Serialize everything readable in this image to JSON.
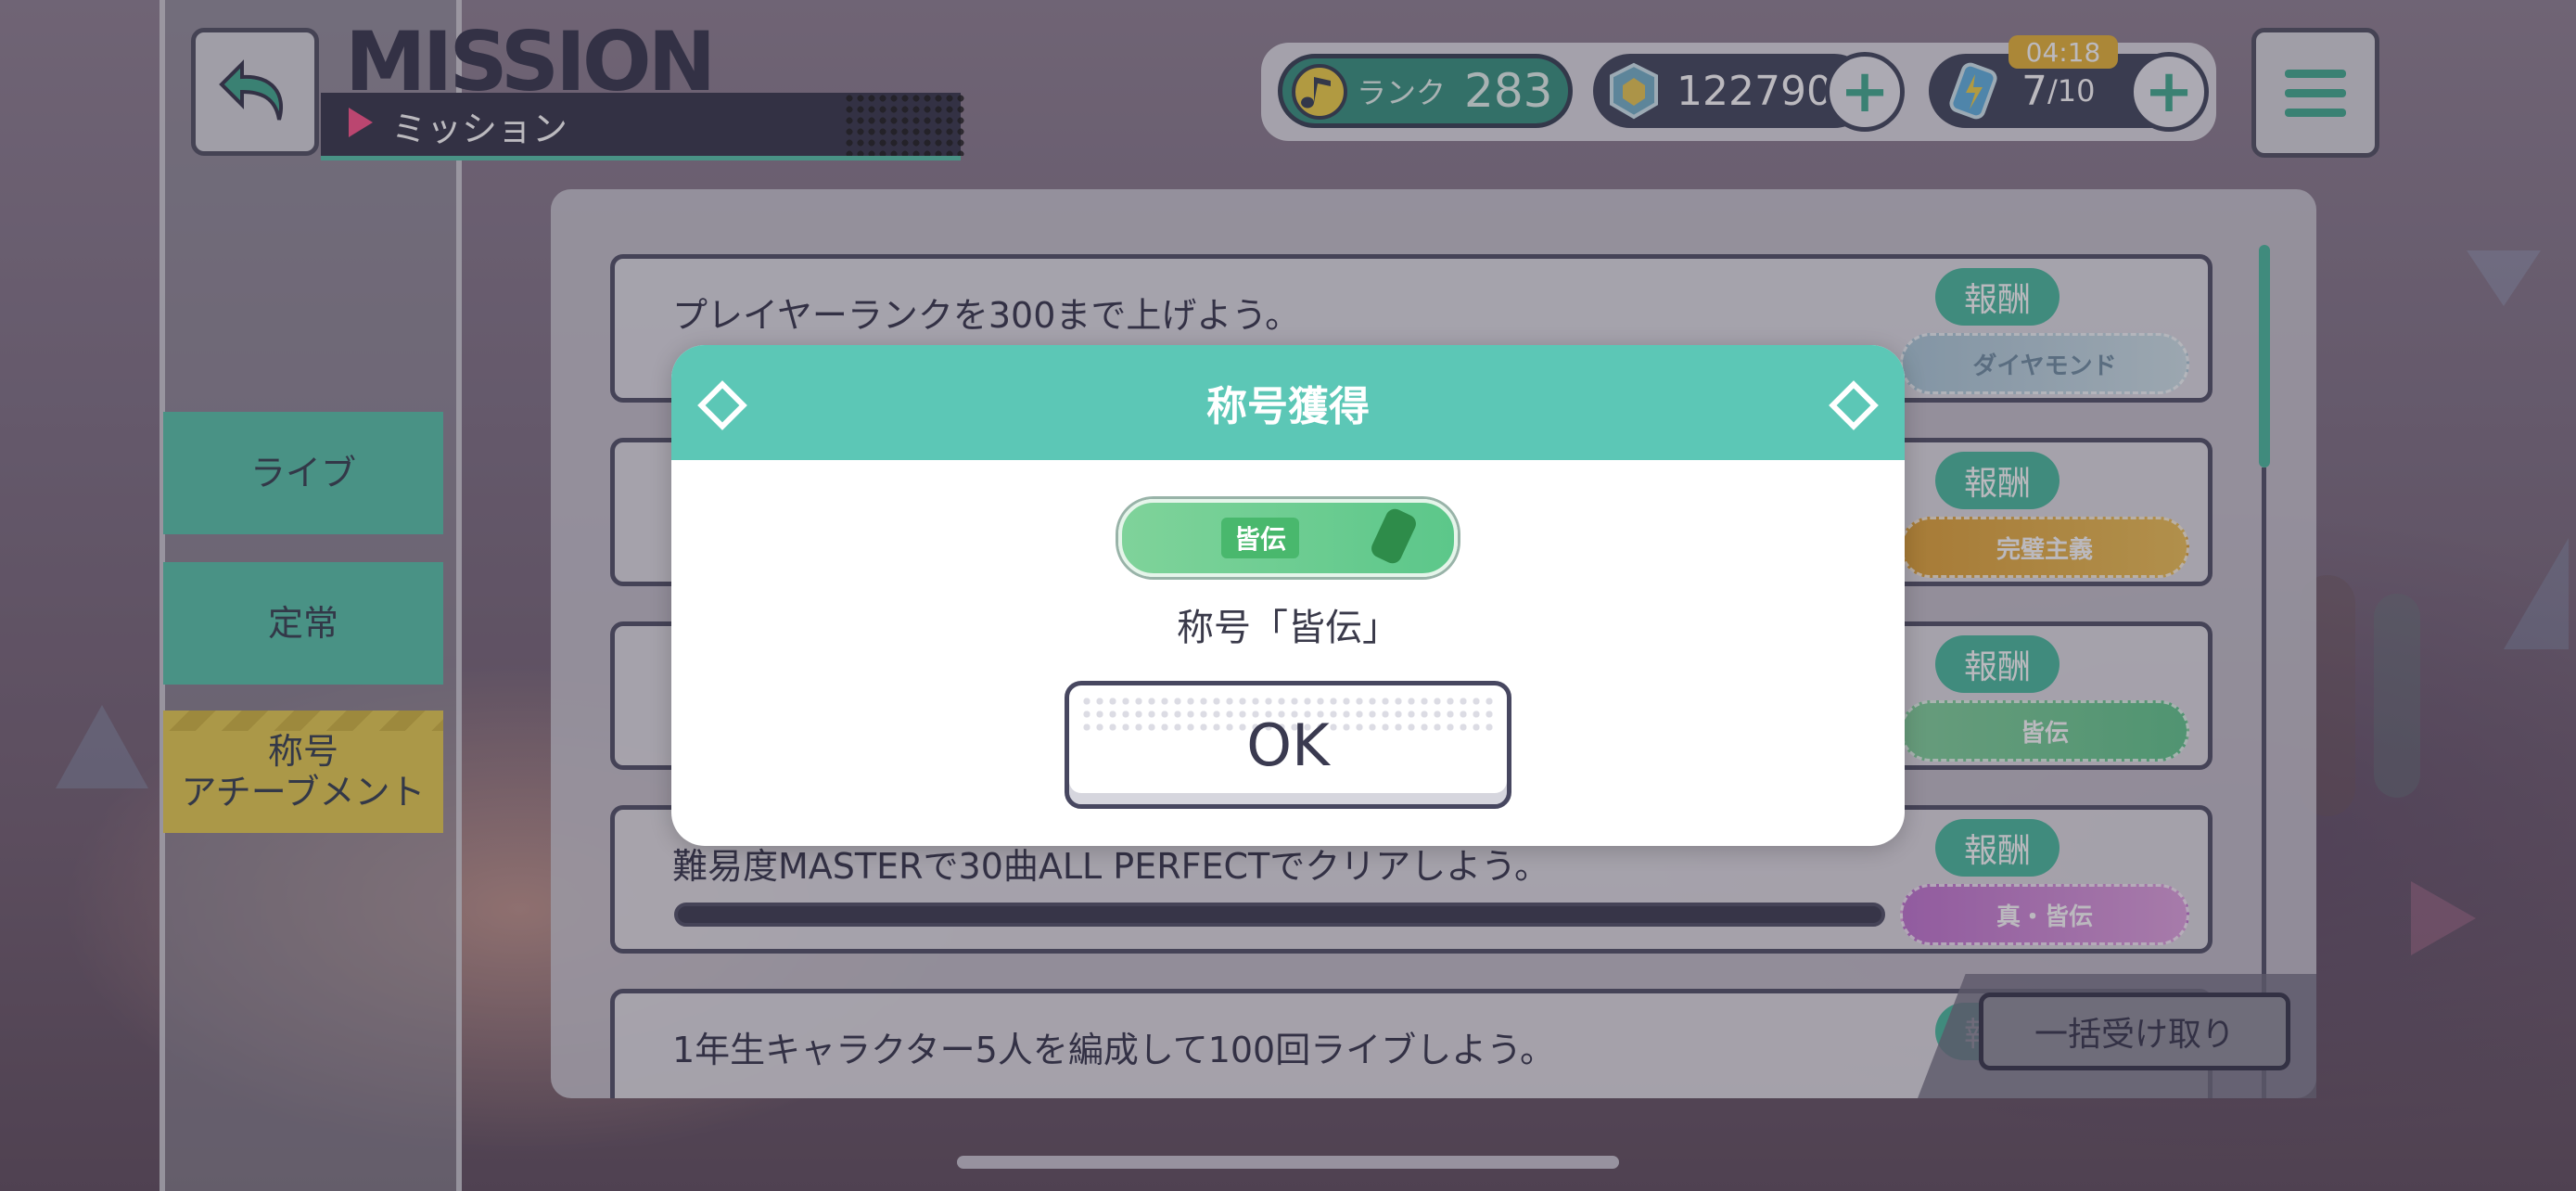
{
  "header": {
    "title_en": "MISSION",
    "title_jp": "ミッション"
  },
  "resources": {
    "rank_label": "ランク",
    "rank_value": "283",
    "gems": "122790",
    "energy_current": "7",
    "energy_max": "/10",
    "energy_timer": "04:18"
  },
  "nav": {
    "items": [
      {
        "label": "ライブ"
      },
      {
        "label": "定常"
      },
      {
        "label": "称号\nアチーブメント"
      }
    ]
  },
  "missions": [
    {
      "text": "プレイヤーランクを300まで上げよう。",
      "reward_label": "報酬",
      "reward_item": "ダイヤモンド"
    },
    {
      "text": "",
      "reward_label": "報酬",
      "reward_item": "完璧主義"
    },
    {
      "text": "",
      "reward_label": "報酬",
      "reward_item": "皆伝"
    },
    {
      "text": "難易度MASTERで30曲ALL PERFECTでクリアしよう。",
      "reward_label": "報酬",
      "reward_item": "真・皆伝"
    },
    {
      "text": "1年生キャラクター5人を編成して100回ライブしよう。",
      "reward_label": "報酬",
      "reward_item": ""
    }
  ],
  "claim_all": "一括受け取り",
  "modal": {
    "title": "称号獲得",
    "badge_text": "皆伝",
    "caption": "称号「皆伝」",
    "ok": "OK"
  },
  "colors": {
    "accent_teal": "#5cc7b6",
    "nav_active": "#e7cd4a",
    "dark": "#2f2f44"
  }
}
